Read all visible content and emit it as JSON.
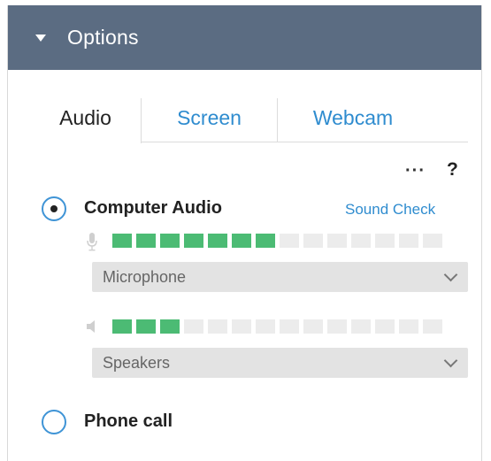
{
  "header": {
    "title": "Options"
  },
  "tabs": [
    {
      "label": "Audio",
      "active": true
    },
    {
      "label": "Screen",
      "active": false
    },
    {
      "label": "Webcam",
      "active": false
    }
  ],
  "toolbar": {
    "more_label": "···",
    "help_label": "?"
  },
  "audio": {
    "computer_audio": {
      "label": "Computer Audio",
      "selected": true,
      "sound_check_label": "Sound Check"
    },
    "microphone": {
      "level_segments_on": 7,
      "level_segments_total": 14,
      "selected": "Microphone"
    },
    "speakers": {
      "level_segments_on": 3,
      "level_segments_total": 14,
      "selected": "Speakers"
    },
    "phone_call": {
      "label": "Phone call",
      "selected": false
    }
  },
  "colors": {
    "header_bg": "#5b6c82",
    "accent": "#2f8ccf",
    "meter_on": "#4cbb74",
    "meter_off": "#ececec"
  }
}
